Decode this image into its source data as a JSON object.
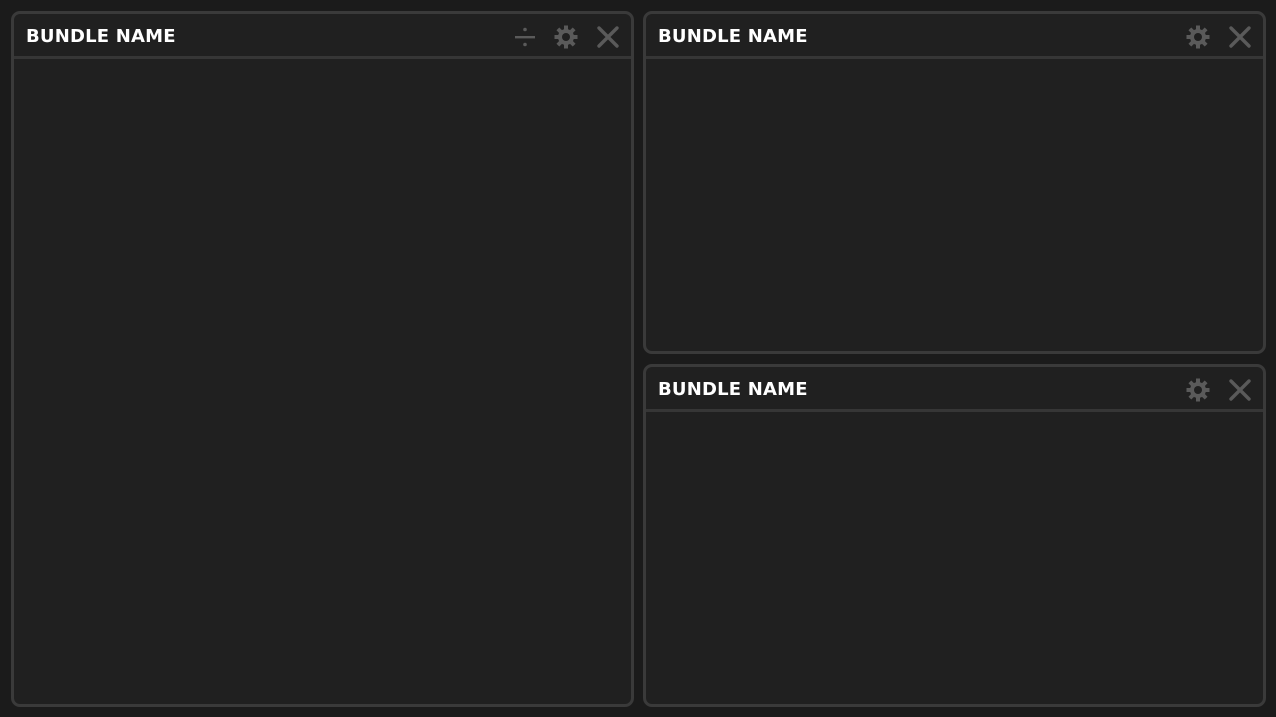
{
  "panels": [
    {
      "title": "BUNDLE NAME",
      "icons": [
        "divide-icon",
        "gear-icon",
        "close-icon"
      ]
    },
    {
      "title": "BUNDLE NAME",
      "icons": [
        "gear-icon",
        "close-icon"
      ]
    },
    {
      "title": "BUNDLE NAME",
      "icons": [
        "gear-icon",
        "close-icon"
      ]
    }
  ],
  "colors": {
    "background": "#1b1b1b",
    "panel_fill": "#202020",
    "panel_border": "#3a3a3a",
    "icon": "#5a5a5a",
    "title_text": "#ffffff"
  }
}
